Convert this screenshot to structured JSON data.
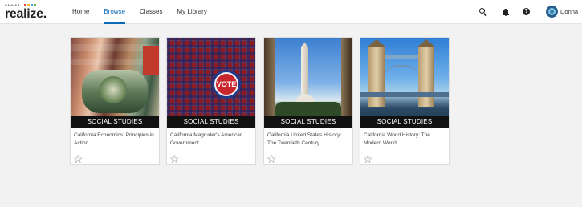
{
  "brand": {
    "small": "SAVVAS",
    "name": "realize.",
    "dot_colors": [
      "#e24a3b",
      "#f3b233",
      "#4aa3df",
      "#6cc04a"
    ]
  },
  "nav": {
    "items": [
      {
        "label": "Home",
        "active": false
      },
      {
        "label": "Browse",
        "active": true
      },
      {
        "label": "Classes",
        "active": false
      },
      {
        "label": "My Library",
        "active": false
      }
    ]
  },
  "header": {
    "icons": [
      "search-icon",
      "bell-icon",
      "help-icon"
    ],
    "help_glyph": "?",
    "user_name": "Donna"
  },
  "colors": {
    "accent": "#0a6bb5",
    "ribbon": "#111111",
    "background": "#f2f2f2"
  },
  "cards": [
    {
      "ribbon": "SOCIAL STUDIES",
      "title": "California Economics: Principles in Action",
      "star": "☆"
    },
    {
      "ribbon": "SOCIAL STUDIES",
      "title": "California Magruder's American Government",
      "star": "☆",
      "pin_text": "VOTE"
    },
    {
      "ribbon": "SOCIAL STUDIES",
      "title": "California United States History: The Twentieth Century",
      "star": "☆"
    },
    {
      "ribbon": "SOCIAL STUDIES",
      "title": "California World History: The Modern World",
      "star": "☆"
    }
  ]
}
